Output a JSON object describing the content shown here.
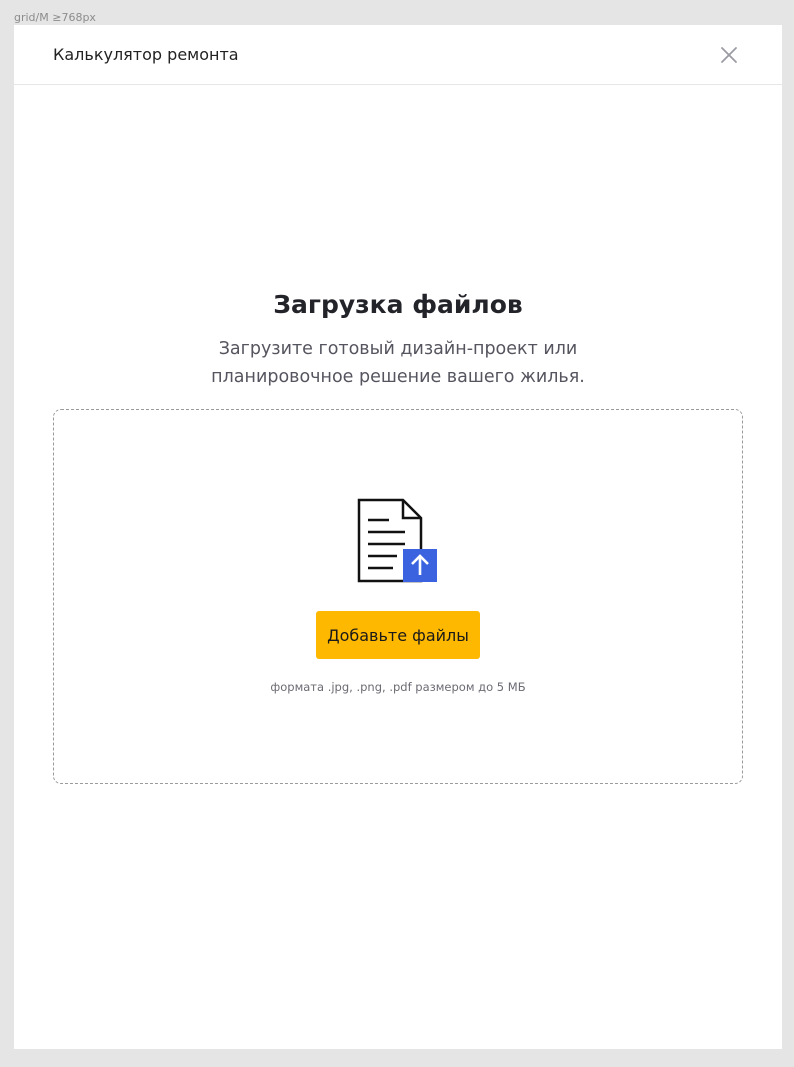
{
  "grid_label": "grid/M ≥768px",
  "header": {
    "title": "Калькулятор ремонта"
  },
  "icons": {
    "close": "close-icon",
    "file_upload": "file-upload-icon"
  },
  "upload": {
    "title": "Загрузка файлов",
    "description": "Загрузите готовый дизайн-проект или планировочное решение вашего жилья.",
    "button_label": "Добавьте файлы",
    "formats_hint": "формата .jpg, .png, .pdf размером до 5 МБ"
  },
  "colors": {
    "accent_button": "#ffb800",
    "upload_arrow_badge": "#3b63e0",
    "background": "#e5e5e5"
  }
}
